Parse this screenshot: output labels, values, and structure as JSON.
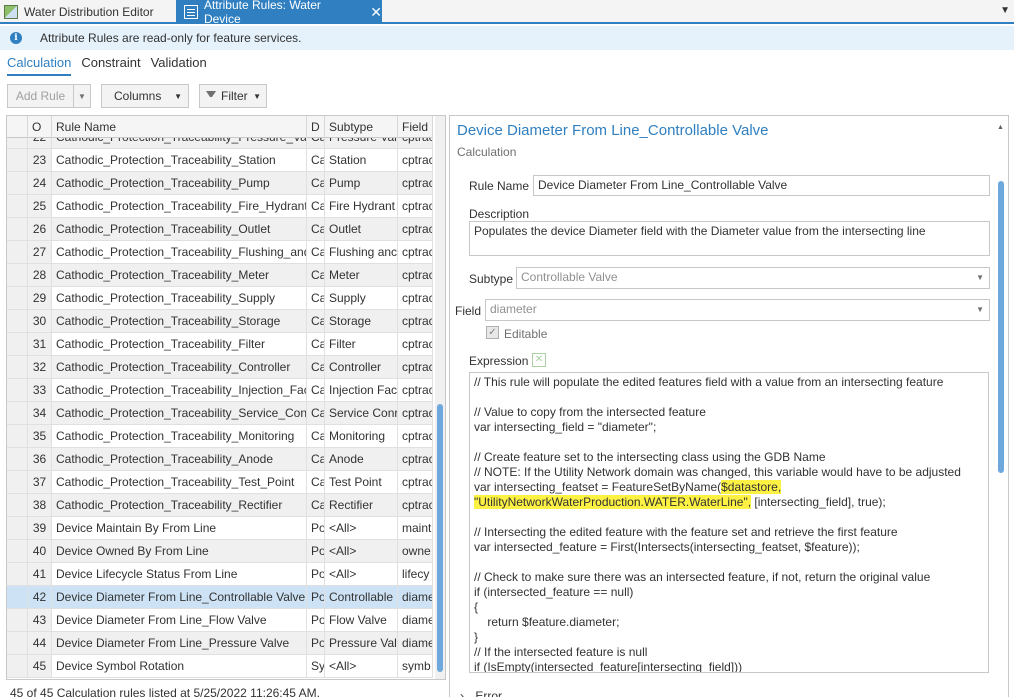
{
  "tabs": [
    {
      "label": "Water Distribution Editor",
      "icon": "map-icon"
    },
    {
      "label": "Attribute Rules: Water Device",
      "icon": "table-icon",
      "close": "✕"
    }
  ],
  "info": {
    "text": "Attribute Rules are read-only for feature services."
  },
  "subtabs": [
    "Calculation",
    "Constraint",
    "Validation"
  ],
  "toolbar": {
    "add_rule": "Add Rule",
    "columns": "Columns",
    "filter": "Filter"
  },
  "grid": {
    "headers": [
      "O",
      "Rule Name",
      "D",
      "Subtype",
      "Field"
    ],
    "rows": [
      {
        "o": "22",
        "name": "Cathodic_Protection_Traceability_Pressure_Valv",
        "d": "Ca",
        "subtype": "Pressure Valv",
        "field": "cptrac"
      },
      {
        "o": "23",
        "name": "Cathodic_Protection_Traceability_Station",
        "d": "Ca",
        "subtype": "Station",
        "field": "cptrac"
      },
      {
        "o": "24",
        "name": "Cathodic_Protection_Traceability_Pump",
        "d": "Ca",
        "subtype": "Pump",
        "field": "cptrac"
      },
      {
        "o": "25",
        "name": "Cathodic_Protection_Traceability_Fire_Hydrant",
        "d": "Ca",
        "subtype": "Fire Hydrant",
        "field": "cptrac"
      },
      {
        "o": "26",
        "name": "Cathodic_Protection_Traceability_Outlet",
        "d": "Ca",
        "subtype": "Outlet",
        "field": "cptrac"
      },
      {
        "o": "27",
        "name": "Cathodic_Protection_Traceability_Flushing_and_",
        "d": "Ca",
        "subtype": "Flushing anc",
        "field": "cptrac"
      },
      {
        "o": "28",
        "name": "Cathodic_Protection_Traceability_Meter",
        "d": "Ca",
        "subtype": "Meter",
        "field": "cptrac"
      },
      {
        "o": "29",
        "name": "Cathodic_Protection_Traceability_Supply",
        "d": "Ca",
        "subtype": "Supply",
        "field": "cptrac"
      },
      {
        "o": "30",
        "name": "Cathodic_Protection_Traceability_Storage",
        "d": "Ca",
        "subtype": "Storage",
        "field": "cptrac"
      },
      {
        "o": "31",
        "name": "Cathodic_Protection_Traceability_Filter",
        "d": "Ca",
        "subtype": "Filter",
        "field": "cptrac"
      },
      {
        "o": "32",
        "name": "Cathodic_Protection_Traceability_Controller",
        "d": "Ca",
        "subtype": "Controller",
        "field": "cptrac"
      },
      {
        "o": "33",
        "name": "Cathodic_Protection_Traceability_Injection_Faci",
        "d": "Ca",
        "subtype": "Injection Fac",
        "field": "cptrac"
      },
      {
        "o": "34",
        "name": "Cathodic_Protection_Traceability_Service_Conn",
        "d": "Ca",
        "subtype": "Service Conr",
        "field": "cptrac"
      },
      {
        "o": "35",
        "name": "Cathodic_Protection_Traceability_Monitoring",
        "d": "Ca",
        "subtype": "Monitoring",
        "field": "cptrac"
      },
      {
        "o": "36",
        "name": "Cathodic_Protection_Traceability_Anode",
        "d": "Ca",
        "subtype": "Anode",
        "field": "cptrac"
      },
      {
        "o": "37",
        "name": "Cathodic_Protection_Traceability_Test_Point",
        "d": "Ca",
        "subtype": "Test Point",
        "field": "cptrac"
      },
      {
        "o": "38",
        "name": "Cathodic_Protection_Traceability_Rectifier",
        "d": "Ca",
        "subtype": "Rectifier",
        "field": "cptrac"
      },
      {
        "o": "39",
        "name": "Device Maintain By From Line",
        "d": "Po",
        "subtype": "<All>",
        "field": "maint"
      },
      {
        "o": "40",
        "name": "Device Owned By From Line",
        "d": "Po",
        "subtype": "<All>",
        "field": "owne"
      },
      {
        "o": "41",
        "name": "Device Lifecycle Status From Line",
        "d": "Po",
        "subtype": "<All>",
        "field": "lifecy"
      },
      {
        "o": "42",
        "name": "Device Diameter From Line_Controllable Valve",
        "d": "Po",
        "subtype": "Controllable",
        "field": "diame"
      },
      {
        "o": "43",
        "name": "Device Diameter From Line_Flow Valve",
        "d": "Po",
        "subtype": "Flow Valve",
        "field": "diame"
      },
      {
        "o": "44",
        "name": "Device Diameter From Line_Pressure Valve",
        "d": "Po",
        "subtype": "Pressure Valv",
        "field": "diame"
      },
      {
        "o": "45",
        "name": "Device Symbol  Rotation",
        "d": "Sy",
        "subtype": "<All>",
        "field": "symb"
      }
    ]
  },
  "status": "45 of 45 Calculation rules listed at 5/25/2022 11:26:45 AM.",
  "detail": {
    "title": "Device Diameter From Line_Controllable Valve",
    "section": "Calculation",
    "rule_name_label": "Rule Name",
    "rule_name_value": "Device Diameter From Line_Controllable Valve",
    "description_label": "Description",
    "description_value": "Populates the device Diameter field with the Diameter value from the intersecting line",
    "subtype_label": "Subtype",
    "subtype_value": "Controllable Valve",
    "field_label": "Field",
    "field_value": "diameter",
    "editable_label": "Editable",
    "editable_check": "✓",
    "expression_label": "Expression",
    "expression_clear_icon": "✕",
    "error_label": "Error",
    "code": {
      "l1": "// This rule will populate the edited features field with a value from an intersecting feature",
      "l2": "// Value to copy from the intersected feature",
      "l3": "var intersecting_field = \"diameter\";",
      "l4": "// Create feature set to the intersecting class using the GDB Name",
      "l5": "// NOTE: If the Utility Network domain was changed, this variable would have to be adjusted",
      "l6a": "var intersecting_featset = FeatureSetByName(",
      "l6b": "$datastore,",
      "l7a": "\"UtilityNetworkWaterProduction.WATER.WaterLine\",",
      "l7b": " [intersecting_field], true);",
      "l8": "// Intersecting the edited feature with the feature set and retrieve the first feature",
      "l9": "var intersected_feature = First(Intersects(intersecting_featset, $feature));",
      "l10": "// Check to make sure there was an intersected feature, if not, return the original value",
      "l11": "if (intersected_feature == null)",
      "l12": "{",
      "l13": "    return $feature.diameter;",
      "l14": "}",
      "l15": "// If the intersected feature is null",
      "l16": "if (IsEmpty(intersected_feature[intersecting_field]))"
    }
  }
}
